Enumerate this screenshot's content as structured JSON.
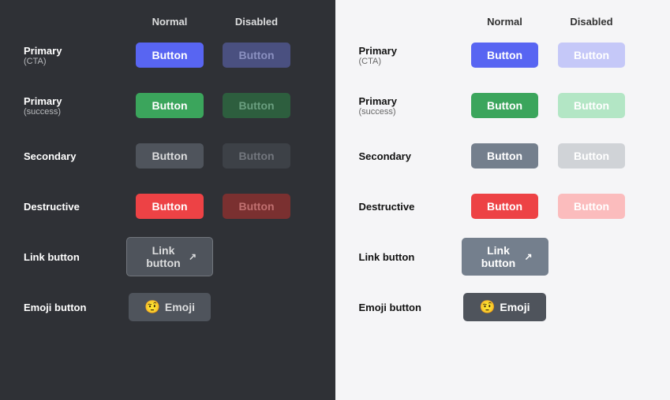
{
  "dark_panel": {
    "columns": {
      "normal": "Normal",
      "disabled": "Disabled"
    },
    "rows": [
      {
        "label": "Primary",
        "sub": "(CTA)",
        "name": "primary-cta",
        "normal_class": "dark-primary-cta",
        "disabled_class": "dark-primary-cta-disabled",
        "normal_text": "Button",
        "disabled_text": "Button"
      },
      {
        "label": "Primary",
        "sub": "(success)",
        "name": "primary-success",
        "normal_class": "dark-primary-success",
        "disabled_class": "dark-primary-success-disabled",
        "normal_text": "Button",
        "disabled_text": "Button"
      },
      {
        "label": "Secondary",
        "sub": "",
        "name": "secondary",
        "normal_class": "dark-secondary",
        "disabled_class": "dark-secondary-disabled",
        "normal_text": "Button",
        "disabled_text": "Button"
      },
      {
        "label": "Destructive",
        "sub": "",
        "name": "destructive",
        "normal_class": "dark-destructive",
        "disabled_class": "dark-destructive-disabled",
        "normal_text": "Button",
        "disabled_text": "Button"
      }
    ],
    "link_label": "Link button",
    "link_text": "Link button",
    "emoji_label": "Emoji button",
    "emoji_text": "Emoji",
    "emoji_icon": "🤨"
  },
  "light_panel": {
    "columns": {
      "normal": "Normal",
      "disabled": "Disabled"
    },
    "rows": [
      {
        "label": "Primary",
        "sub": "(CTA)",
        "name": "primary-cta",
        "normal_class": "light-primary-cta",
        "disabled_class": "light-primary-cta-disabled",
        "normal_text": "Button",
        "disabled_text": "Button"
      },
      {
        "label": "Primary",
        "sub": "(success)",
        "name": "primary-success",
        "normal_class": "light-primary-success",
        "disabled_class": "light-primary-success-disabled",
        "normal_text": "Button",
        "disabled_text": "Button"
      },
      {
        "label": "Secondary",
        "sub": "",
        "name": "secondary",
        "normal_class": "light-secondary",
        "disabled_class": "light-secondary-disabled",
        "normal_text": "Button",
        "disabled_text": "Button"
      },
      {
        "label": "Destructive",
        "sub": "",
        "name": "destructive",
        "normal_class": "light-destructive",
        "disabled_class": "light-destructive-disabled",
        "normal_text": "Button",
        "disabled_text": "Button"
      }
    ],
    "link_label": "Link button",
    "link_text": "Link button",
    "emoji_label": "Emoji button",
    "emoji_text": "Emoji",
    "emoji_icon": "🤨"
  }
}
